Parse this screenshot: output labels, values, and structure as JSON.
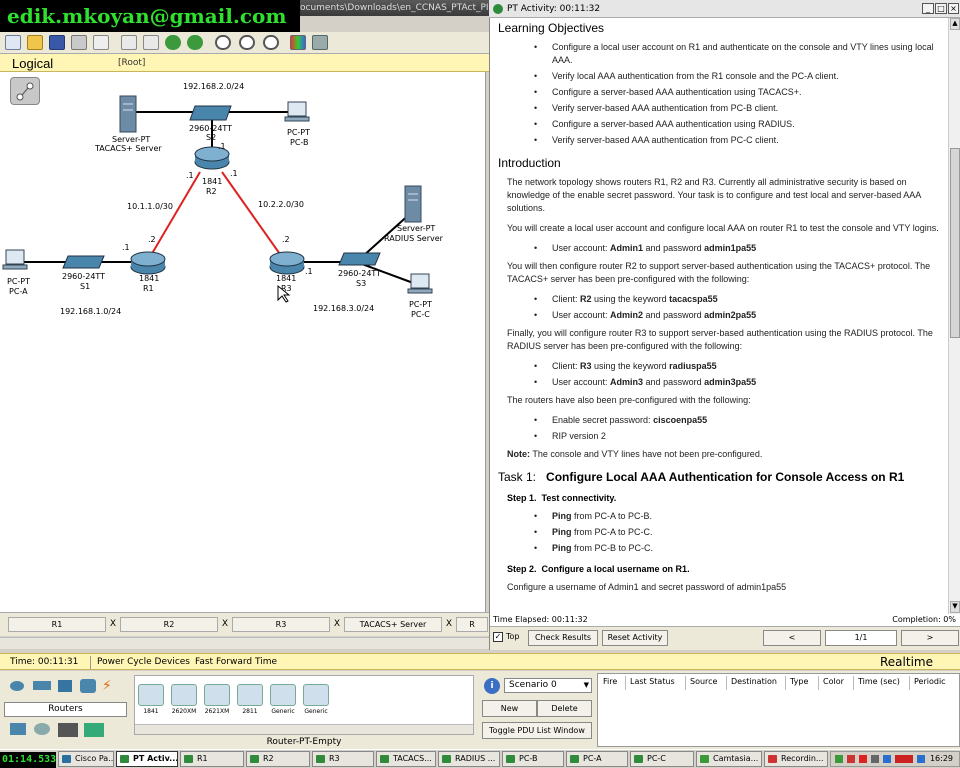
{
  "overlay": {
    "email": "edik.mkoyan@gmail.com",
    "timer": "01:14.533"
  },
  "pt_window": {
    "title_path": "ocuments\\Downloads\\en_CCNAS_PTAct_PI"
  },
  "workspace": {
    "mode_label": "Logical",
    "root_label": "[Root]",
    "networks": {
      "net2": "192.168.2.0/24",
      "net1": "192.168.1.0/24",
      "net3": "192.168.3.0/24",
      "link12": "10.1.1.0/30",
      "link23": "10.2.2.0/30"
    },
    "devices": {
      "tacacs_server": [
        "Server-PT",
        "TACACS+ Server"
      ],
      "s2": [
        "2960-24TT",
        "S2"
      ],
      "pc_b": [
        "PC-PT",
        "PC-B"
      ],
      "r2": [
        "1841",
        "R2"
      ],
      "radius_server": [
        "Server-PT",
        "RADIUS Server"
      ],
      "pc_a": [
        "PC-PT",
        "PC-A"
      ],
      "s1": [
        "2960-24TT",
        "S1"
      ],
      "r1": [
        "1841",
        "R1"
      ],
      "r3": [
        "1841",
        "R3"
      ],
      "s3": [
        "2960-24TT",
        "S3"
      ],
      "pc_c": [
        "PC-PT",
        "PC-C"
      ]
    },
    "ifaces": {
      "r2_top": ".1",
      "r2_left": ".1",
      "r2_right": ".1",
      "r1_top": ".2",
      "r1_left": ".1",
      "r3_top": ".2",
      "r3_right": ".1"
    }
  },
  "device_tabs": [
    "R1",
    "R2",
    "R3",
    "TACACS+ Server",
    "R"
  ],
  "activity": {
    "title": "PT Activity: 00:11:32",
    "learning_heading": "Learning Objectives",
    "objectives": [
      "Configure a local user account on R1 and authenticate on the console and VTY lines using local AAA.",
      "Verify local AAA authentication from the R1 console and the PC-A client.",
      "Configure a server-based AAA authentication using TACACS+.",
      "Verify server-based AAA authentication from PC-B client.",
      "Configure a server-based AAA authentication using RADIUS.",
      "Verify server-based AAA authentication from PC-C client."
    ],
    "intro_heading": "Introduction",
    "intro_p1": "The network topology shows routers R1, R2 and R3. Currently all administrative security is based on knowledge of the enable secret password. Your task is to configure and test local and server-based AAA solutions.",
    "intro_p2": "You will create a local user account and configure local AAA on router R1 to test the console and VTY logins.",
    "user1": {
      "a": "User account: ",
      "b": "Admin1",
      "c": " and password ",
      "d": "admin1pa55"
    },
    "intro_p3": "You will then configure router R2 to support server-based authentication using the TACACS+ protocol. The TACACS+ server has been pre-configured with the following:",
    "client2": {
      "a": "Client: ",
      "b": "R2",
      "c": " using the keyword ",
      "d": "tacacspa55"
    },
    "user2": {
      "a": "User account: ",
      "b": "Admin2",
      "c": " and password ",
      "d": "admin2pa55"
    },
    "intro_p4": "Finally, you will configure router R3 to support server-based authentication using the RADIUS protocol. The RADIUS server has been pre-configured with the following:",
    "client3": {
      "a": "Client: ",
      "b": "R3",
      "c": " using the keyword ",
      "d": "radiuspa55"
    },
    "user3": {
      "a": "User account: ",
      "b": "Admin3",
      "c": " and password ",
      "d": "admin3pa55"
    },
    "intro_p5": "The routers have also been pre-configured with the following:",
    "enable": {
      "a": "Enable secret password: ",
      "b": "ciscoenpa55"
    },
    "rip": "RIP version 2",
    "note": {
      "a": "Note:",
      "b": " The console and VTY lines have not been pre-configured."
    },
    "task1": {
      "num": "Task 1:",
      "text": "Configure Local AAA Authentication for Console Access on R1"
    },
    "step1": {
      "num": "Step 1.",
      "text": "Test connectivity."
    },
    "pings": [
      {
        "a": "Ping",
        "b": " from PC-A to PC-B."
      },
      {
        "a": "Ping",
        "b": " from PC-A to PC-C."
      },
      {
        "a": "Ping",
        "b": " from PC-B to PC-C."
      }
    ],
    "step2": {
      "num": "Step 2.",
      "text": "Configure a local username on R1."
    },
    "cut_line": "Configure a username of Admin1 and secret password of admin1pa55",
    "time_elapsed": "Time Elapsed: 00:11:32",
    "completion": "Completion: 0%",
    "top_label": "Top",
    "check_results": "Check Results",
    "reset_activity": "Reset Activity",
    "prev": "<",
    "page": "1/1",
    "next": ">"
  },
  "statusbar": {
    "time": "Time: 00:11:31",
    "power": "Power Cycle Devices",
    "ff": "Fast Forward Time",
    "mode": "Realtime"
  },
  "device_panel": {
    "category": "Routers",
    "models": [
      "1841",
      "2620XM",
      "2621XM",
      "2811",
      "Generic",
      "Generic"
    ],
    "selected": "Router-PT-Empty"
  },
  "pdu": {
    "scenario": "Scenario 0",
    "new": "New",
    "delete": "Delete",
    "toggle": "Toggle PDU List Window",
    "columns": [
      "Fire",
      "Last Status",
      "Source",
      "Destination",
      "Type",
      "Color",
      "Time (sec)",
      "Periodic"
    ]
  },
  "taskbar": {
    "items": [
      "Cisco Pa...",
      "PT Activ...",
      "R1",
      "R2",
      "R3",
      "TACACS...",
      "RADIUS ...",
      "PC-B",
      "PC-A",
      "PC-C",
      "Camtasia...",
      "Recordin..."
    ],
    "clock": "16:29"
  }
}
